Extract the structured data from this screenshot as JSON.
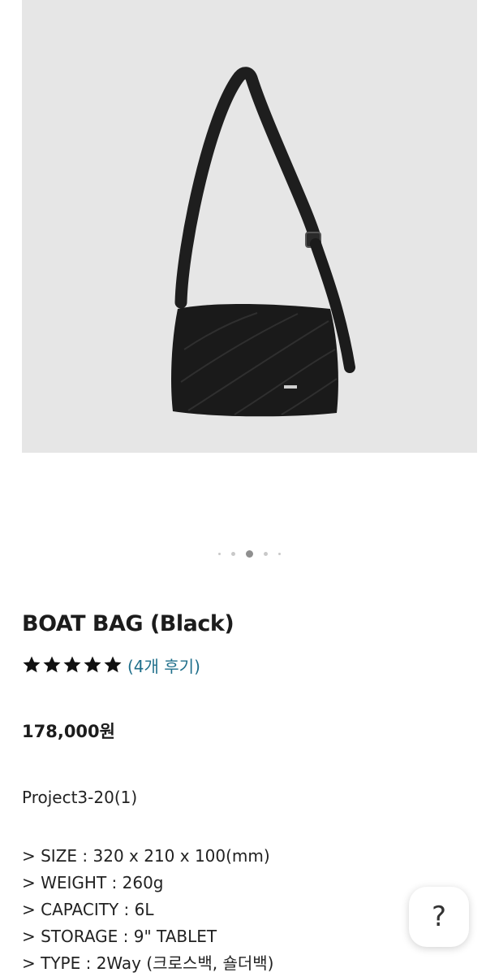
{
  "product": {
    "title": "BOAT BAG (Black)",
    "rating_stars": 5,
    "reviews_label": "(4개 후기)",
    "price": "178,000원",
    "code": "Project3-20(1)",
    "specs": [
      "> SIZE : 320 x 210 x 100(mm)",
      "> WEIGHT : 260g",
      "> CAPACITY : 6L",
      "> STORAGE : 9\" TABLET",
      "> TYPE : 2Way (크로스백, 숄더백)"
    ]
  },
  "gallery": {
    "image_alt": "black quilted boat bag",
    "dots_count": 5,
    "active_index": 2
  },
  "help": {
    "icon": "question-mark-icon",
    "label": "?"
  },
  "colors": {
    "reviews_link": "#1f6f8b",
    "image_bg": "#e6e6e6"
  }
}
